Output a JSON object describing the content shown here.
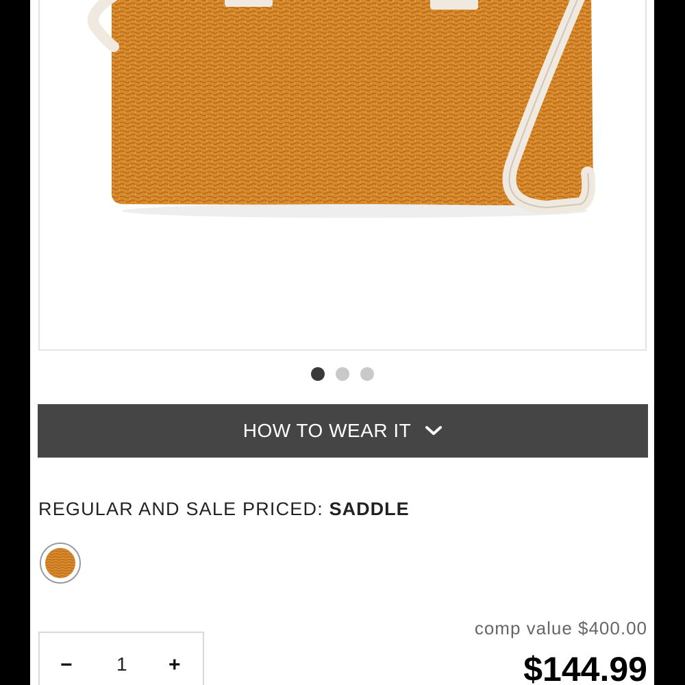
{
  "product": {
    "image_alt_icon": "handbag-image",
    "carousel": {
      "count": 3,
      "active_index": 0
    },
    "color": "#d98a2b"
  },
  "accordion": {
    "label": "HOW TO WEAR IT",
    "icon": "chevron-down-icon"
  },
  "pricing": {
    "label_prefix": "REGULAR AND SALE PRICED:",
    "color_name": "SADDLE",
    "comp_value": "comp value $400.00",
    "sale_price": "$144.99"
  },
  "quantity": {
    "minus": "−",
    "value": "1",
    "plus": "+"
  }
}
